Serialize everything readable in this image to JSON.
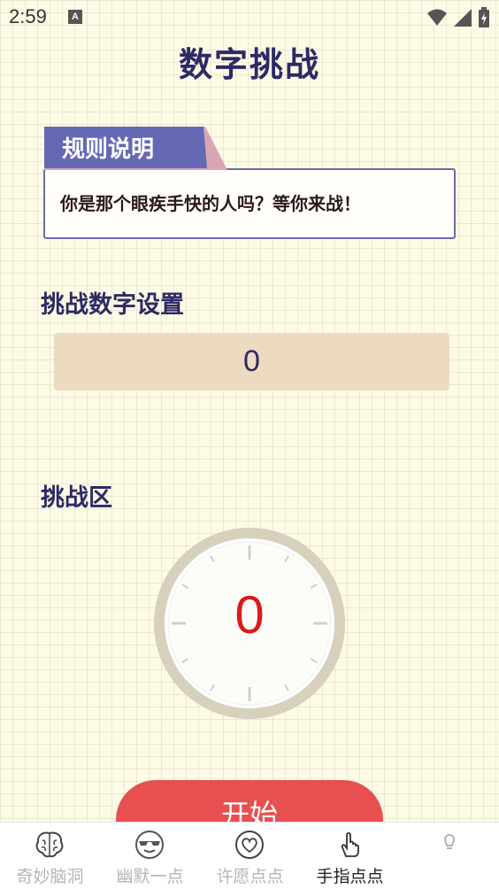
{
  "status_bar": {
    "time": "2:59",
    "notification_icon_letter": "A"
  },
  "header": {
    "title": "数字挑战"
  },
  "rules": {
    "title": "规则说明",
    "text": "你是那个眼疾手快的人吗？等你来战！"
  },
  "setting": {
    "label": "挑战数字设置",
    "value": "0"
  },
  "challenge": {
    "label": "挑战区",
    "display_value": "0"
  },
  "start_button": {
    "label": "开始"
  },
  "nav": {
    "items": [
      {
        "label": "奇妙脑洞",
        "icon": "brain-icon",
        "active": false
      },
      {
        "label": "幽默一点",
        "icon": "sunglasses-face-icon",
        "active": false
      },
      {
        "label": "许愿点点",
        "icon": "heart-icon",
        "active": false
      },
      {
        "label": "手指点点",
        "icon": "hand-pointer-icon",
        "active": true
      },
      {
        "label": "",
        "icon": "bulb-icon",
        "active": false
      }
    ]
  },
  "colors": {
    "accent": "#2e2a66",
    "tab": "#6568b5",
    "start_button": "#e84f50",
    "display_number": "#d81b1b",
    "input_bg": "#eddbc1"
  }
}
